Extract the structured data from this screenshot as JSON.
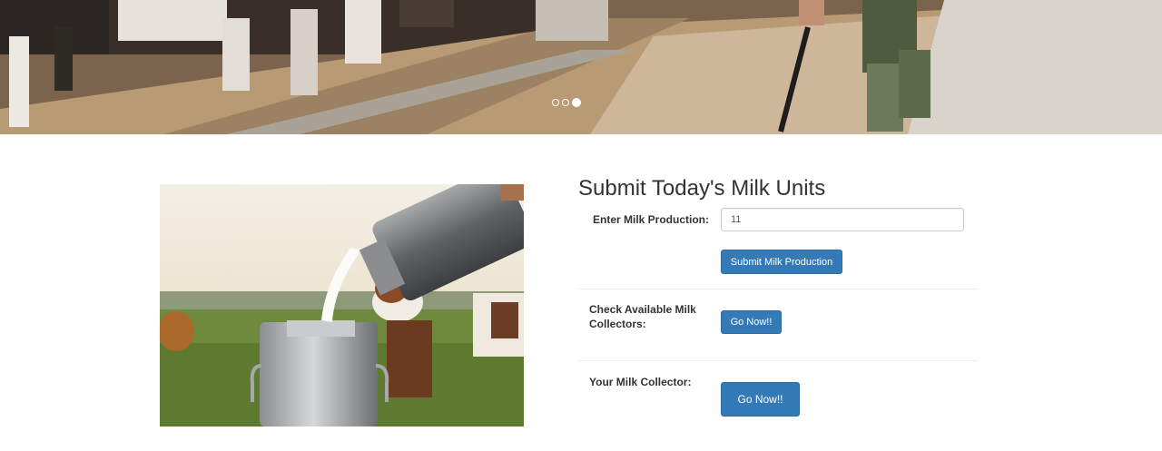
{
  "carousel": {
    "indicators": [
      {
        "active": false
      },
      {
        "active": false
      },
      {
        "active": true
      }
    ]
  },
  "form": {
    "title": "Submit Today's Milk Units",
    "production_label": "Enter Milk Production:",
    "production_value": "11",
    "submit_label": "Submit Milk Production",
    "check_collectors_label": "Check Available Milk Collectors:",
    "check_collectors_button": "Go Now!!",
    "your_collector_label": "Your Milk Collector:",
    "your_collector_button": "Go Now!!"
  },
  "colors": {
    "primary_button": "#337ab7",
    "page_background": "#ffffff"
  }
}
